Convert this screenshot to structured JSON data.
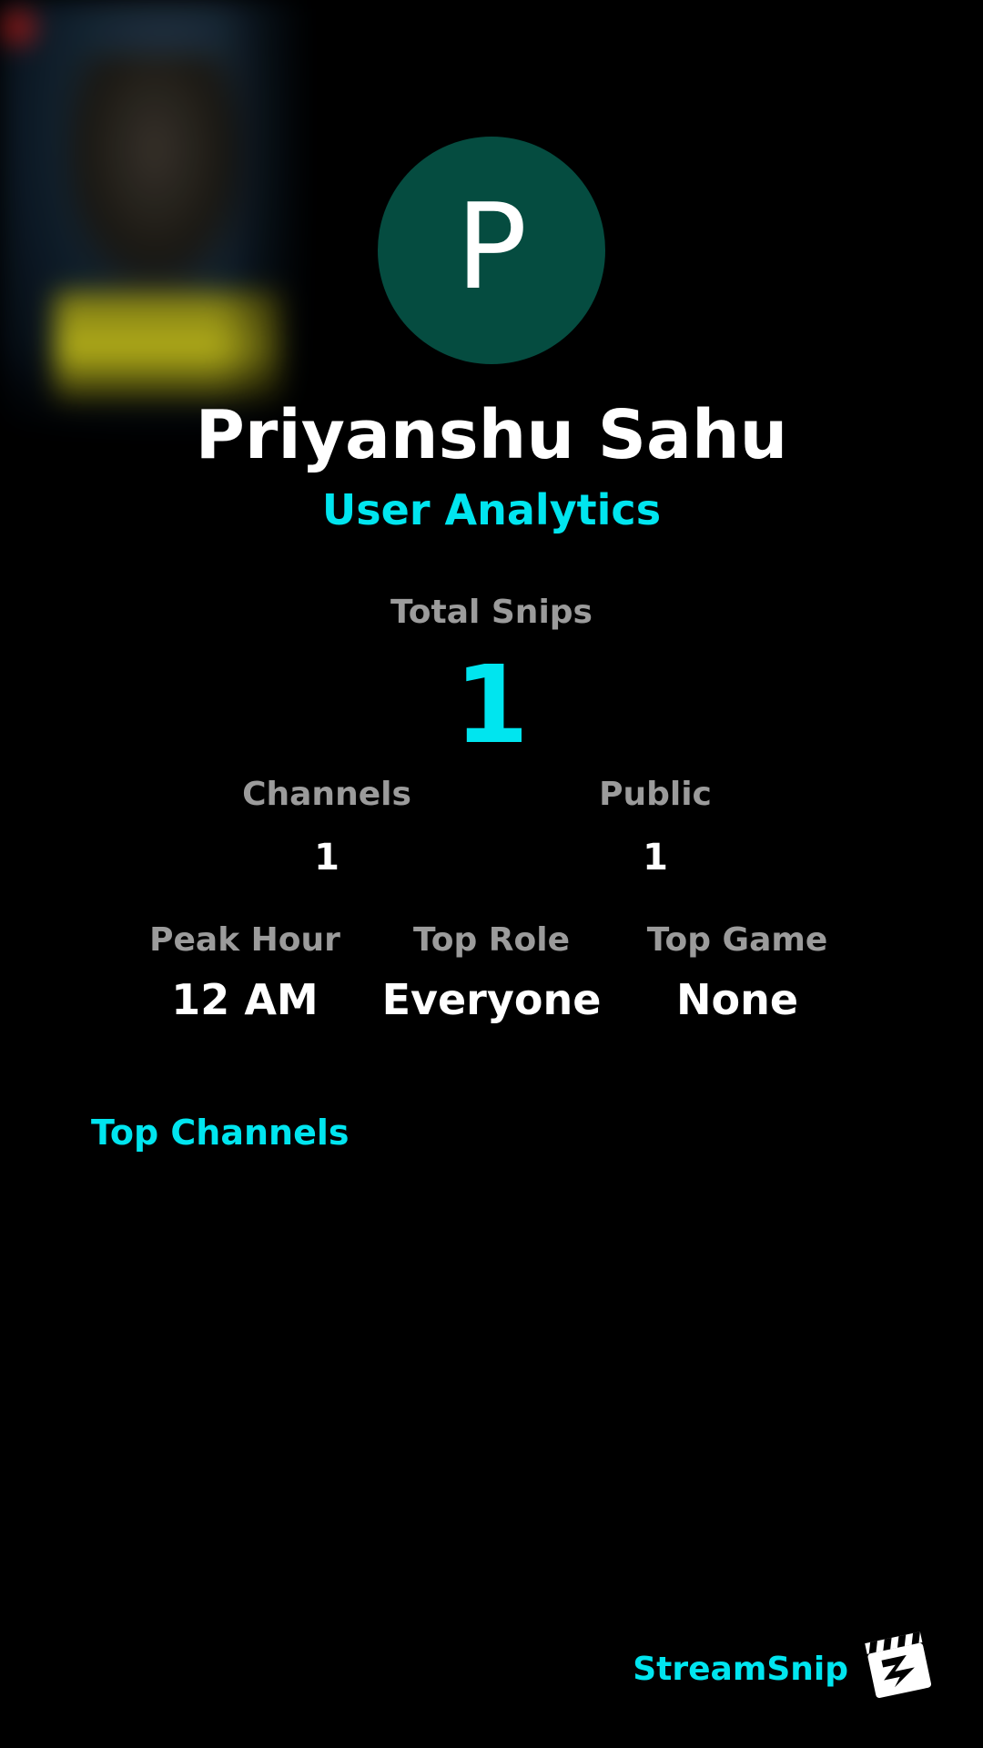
{
  "profile": {
    "avatar_letter": "P",
    "avatar_color": "#054c40",
    "name": "Priyanshu Sahu",
    "subtitle": "User Analytics"
  },
  "totals": {
    "label": "Total Snips",
    "value": "1"
  },
  "stats_row1": [
    {
      "label": "Channels",
      "value": "1"
    },
    {
      "label": "Public",
      "value": "1"
    }
  ],
  "stats_row2": [
    {
      "label": "Peak Hour",
      "value": "12 AM"
    },
    {
      "label": "Top Role",
      "value": "Everyone"
    },
    {
      "label": "Top Game",
      "value": "None"
    }
  ],
  "top_channels": {
    "title": "Top Channels"
  },
  "brand": {
    "name": "StreamSnip",
    "logo_icon": "clapperboard-icon"
  },
  "colors": {
    "accent": "#00e5ef",
    "label_gray": "#9b9b9b",
    "background": "#000000"
  }
}
